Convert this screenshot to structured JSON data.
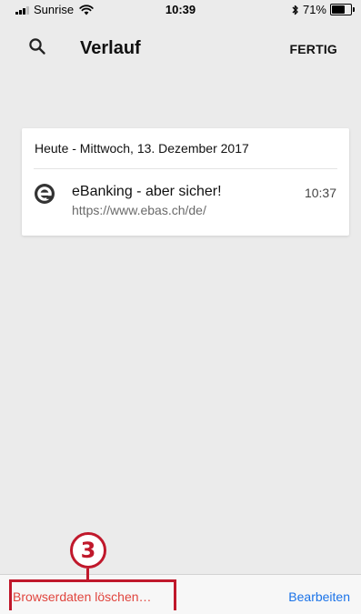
{
  "status_bar": {
    "carrier": "Sunrise",
    "time": "10:39",
    "battery_text": "71%",
    "battery_level": 0.71,
    "icons": [
      "signal-icon",
      "wifi-icon",
      "bluetooth-icon",
      "battery-icon"
    ]
  },
  "header": {
    "title": "Verlauf",
    "done_label": "FERTIG",
    "search_icon": "search-icon"
  },
  "history": {
    "section_heading": "Heute - Mittwoch, 13. Dezember 2017",
    "items": [
      {
        "title": "eBanking - aber sicher!",
        "url": "https://www.ebas.ch/de/",
        "time": "10:37",
        "icon": "ebas-favicon-icon"
      }
    ]
  },
  "toolbar": {
    "clear_data_label": "Browserdaten löschen…",
    "edit_label": "Bearbeiten"
  },
  "annotation": {
    "step_number": "3",
    "color": "#c0182b"
  },
  "colors": {
    "background": "#ebebeb",
    "destructive": "#e0453e",
    "accent_link": "#1b73e8"
  }
}
